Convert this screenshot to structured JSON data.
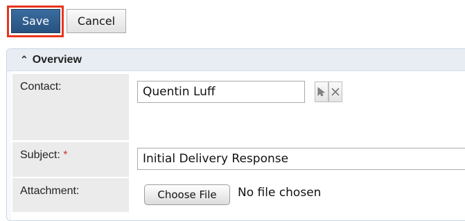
{
  "toolbar": {
    "save_label": "Save",
    "cancel_label": "Cancel"
  },
  "panel": {
    "title": "Overview",
    "collapse_icon": "chevron-double-up-icon"
  },
  "fields": {
    "contact": {
      "label": "Contact:",
      "value": "Quentin Luff",
      "select_icon": "cursor-arrow-icon",
      "clear_icon": "close-icon"
    },
    "subject": {
      "label": "Subject:",
      "required_marker": "*",
      "value": "Initial Delivery Response"
    },
    "attachment": {
      "label": "Attachment:",
      "button_label": "Choose File",
      "status_text": "No file chosen"
    }
  },
  "colors": {
    "save_button": "#2f5f8f",
    "highlight": "#e8341c",
    "required": "#c0392b"
  }
}
